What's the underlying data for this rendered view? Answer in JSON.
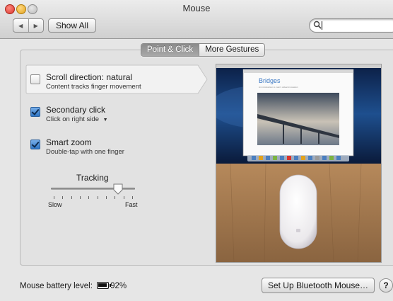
{
  "window": {
    "title": "Mouse"
  },
  "toolbar": {
    "back_icon": "◀",
    "forward_icon": "▶",
    "show_all_label": "Show All",
    "search_value": ""
  },
  "tabs": [
    {
      "label": "Point & Click",
      "selected": true
    },
    {
      "label": "More Gestures",
      "selected": false
    }
  ],
  "options": [
    {
      "title": "Scroll direction: natural",
      "subtitle": "Content tracks finger movement",
      "checked": false
    },
    {
      "title": "Secondary click",
      "subtitle": "Click on right side",
      "checked": true,
      "has_dropdown": true,
      "dropdown_icon": "▼"
    },
    {
      "title": "Smart zoom",
      "subtitle": "Double-tap with one finger",
      "checked": true
    }
  ],
  "tracking": {
    "label": "Tracking",
    "min_label": "Slow",
    "max_label": "Fast",
    "value": 0.8,
    "tick_count": 10
  },
  "preview": {
    "doc_title": "Bridges",
    "doc_subtitle": "An introduction to man's oldest innovation"
  },
  "footer": {
    "battery_label": "Mouse battery level:",
    "battery_value": "92%",
    "battery_fraction": 0.92,
    "setup_button_label": "Set Up Bluetooth Mouse…",
    "help_label": "?"
  },
  "colors": {
    "accent": "#2f76c6",
    "traffic_red": "#d8342c",
    "traffic_yellow": "#e2a21d"
  }
}
